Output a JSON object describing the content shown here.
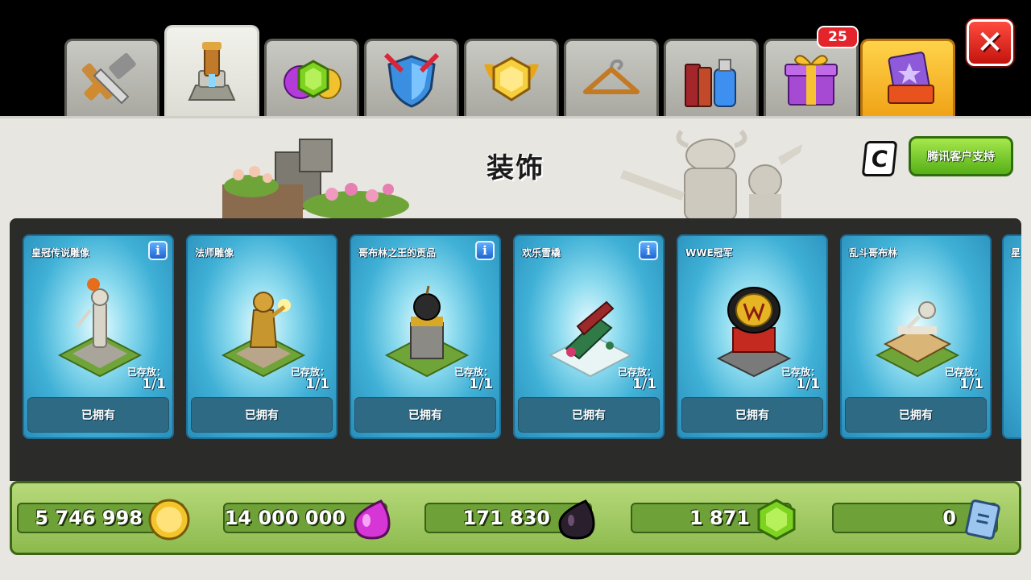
{
  "tabs": [
    {
      "name": "builder",
      "icon": "hammer-saw-icon"
    },
    {
      "name": "decorations",
      "icon": "statue-icon",
      "active": true
    },
    {
      "name": "resources",
      "icon": "gems-coins-icon"
    },
    {
      "name": "defense",
      "icon": "shield-icon"
    },
    {
      "name": "league",
      "icon": "league-badge-icon"
    },
    {
      "name": "skins",
      "icon": "hanger-icon"
    },
    {
      "name": "magic-items",
      "icon": "books-potion-icon"
    },
    {
      "name": "gifts",
      "icon": "gift-icon"
    },
    {
      "name": "shop",
      "icon": "cards-icon"
    }
  ],
  "gift_badge": "25",
  "page_title": "装饰",
  "c_logo": "C",
  "support_button": "腾讯客户支持",
  "cards": [
    {
      "name": "皇冠传说雕像",
      "info": true,
      "store_label": "已存放：",
      "store_value": "1/1",
      "button": "已拥有"
    },
    {
      "name": "法师雕像",
      "info": false,
      "store_label": "已存放：",
      "store_value": "1/1",
      "button": "已拥有"
    },
    {
      "name": "哥布林之王的贡品",
      "info": true,
      "store_label": "已存放：",
      "store_value": "1/1",
      "button": "已拥有"
    },
    {
      "name": "欢乐雪橇",
      "info": true,
      "store_label": "已存放：",
      "store_value": "1/1",
      "button": "已拥有"
    },
    {
      "name": "WWE冠军",
      "info": false,
      "store_label": "已存放：",
      "store_value": "1/1",
      "button": "已拥有"
    },
    {
      "name": "乱斗哥布林",
      "info": false,
      "store_label": "已存放：",
      "store_value": "1/1",
      "button": "已拥有"
    },
    {
      "name": "星",
      "info": false,
      "store_label": "",
      "store_value": "",
      "button": ""
    }
  ],
  "resources": [
    {
      "value": "5 746 998",
      "icon": "gold-coin-icon"
    },
    {
      "value": "14 000 000",
      "icon": "elixir-drop-icon"
    },
    {
      "value": "171 830",
      "icon": "dark-elixir-icon"
    },
    {
      "value": "1 871",
      "icon": "gem-icon"
    },
    {
      "value": "0",
      "icon": "ticket-icon"
    }
  ],
  "colors": {
    "panel": "#e7e6e1",
    "card": "#3fb0d6",
    "resource_bar": "#8cba4e",
    "close": "#e3242b",
    "shop_tab": "#f0a317"
  }
}
